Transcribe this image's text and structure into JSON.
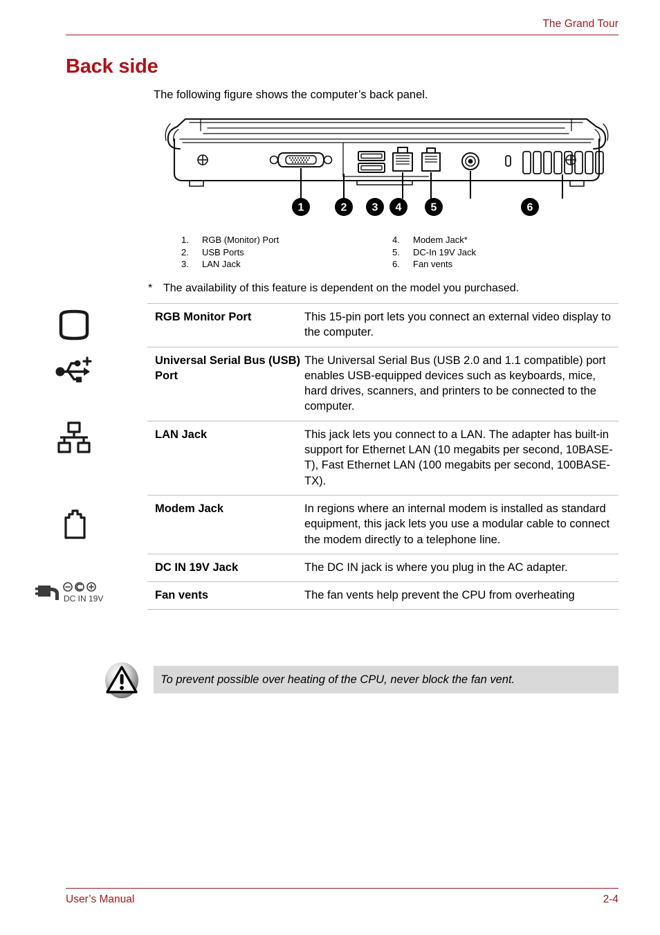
{
  "header": {
    "title": "The Grand Tour",
    "rule_color": "#9e1b20"
  },
  "section": {
    "title": "Back side",
    "title_color": "#b01117",
    "intro": "The following figure shows the computer’s back panel."
  },
  "figure": {
    "name": "laptop-back-panel-diagram",
    "callouts": [
      {
        "number": "1",
        "target": "rgb-monitor-port"
      },
      {
        "number": "2",
        "target": "usb-ports"
      },
      {
        "number": "3",
        "target": "lan-jack"
      },
      {
        "number": "4",
        "target": "modem-jack"
      },
      {
        "number": "5",
        "target": "dc-in-jack"
      },
      {
        "number": "6",
        "target": "fan-vents"
      }
    ]
  },
  "legend": {
    "left": [
      {
        "num": "1.",
        "label": "RGB (Monitor) Port"
      },
      {
        "num": "2.",
        "label": "USB Ports"
      },
      {
        "num": "3.",
        "label": "LAN Jack"
      }
    ],
    "right": [
      {
        "num": "4.",
        "label": "Modem Jack*"
      },
      {
        "num": "5.",
        "label": "DC-In 19V Jack"
      },
      {
        "num": "6.",
        "label": "Fan vents"
      }
    ]
  },
  "footnote": {
    "marker": "*",
    "text": "The availability of this feature is dependent on the model you purchased."
  },
  "table": {
    "rows": [
      {
        "icon": "monitor-icon",
        "term": "RGB Monitor Port",
        "desc": "This 15-pin port lets you connect an external video display to the computer."
      },
      {
        "icon": "usb-icon",
        "term": "Universal Serial Bus (USB) Port",
        "desc": "The Universal Serial Bus (USB 2.0 and 1.1 compatible) port enables USB-equipped devices such as keyboards, mice, hard drives, scanners, and printers to be connected to the computer."
      },
      {
        "icon": "lan-icon",
        "term": "LAN Jack",
        "desc": "This jack lets you connect to a LAN. The adapter has built-in support for Ethernet LAN (10 megabits per second, 10BASE-T), Fast Ethernet LAN (100 megabits per second, 100BASE-TX)."
      },
      {
        "icon": "modem-jack-icon",
        "term": "Modem Jack",
        "desc": "In regions where an internal modem is installed as standard equipment, this jack lets you use a modular cable to connect the modem directly to a telephone line."
      },
      {
        "icon": "dc-in-icon",
        "icon_label": "DC IN 19V",
        "term": "DC IN 19V Jack",
        "desc": "The DC IN jack is where you plug in the AC adapter."
      },
      {
        "icon": "",
        "term": "Fan vents",
        "desc": "The fan vents help prevent the CPU from overheating"
      }
    ]
  },
  "caution": {
    "icon": "warning-triangle-icon",
    "text": "To prevent possible over heating of the CPU, never block the fan vent.",
    "background": "#d9d9d9"
  },
  "footer": {
    "left": "User’s Manual",
    "right": "2-4",
    "color": "#9e1b20"
  }
}
